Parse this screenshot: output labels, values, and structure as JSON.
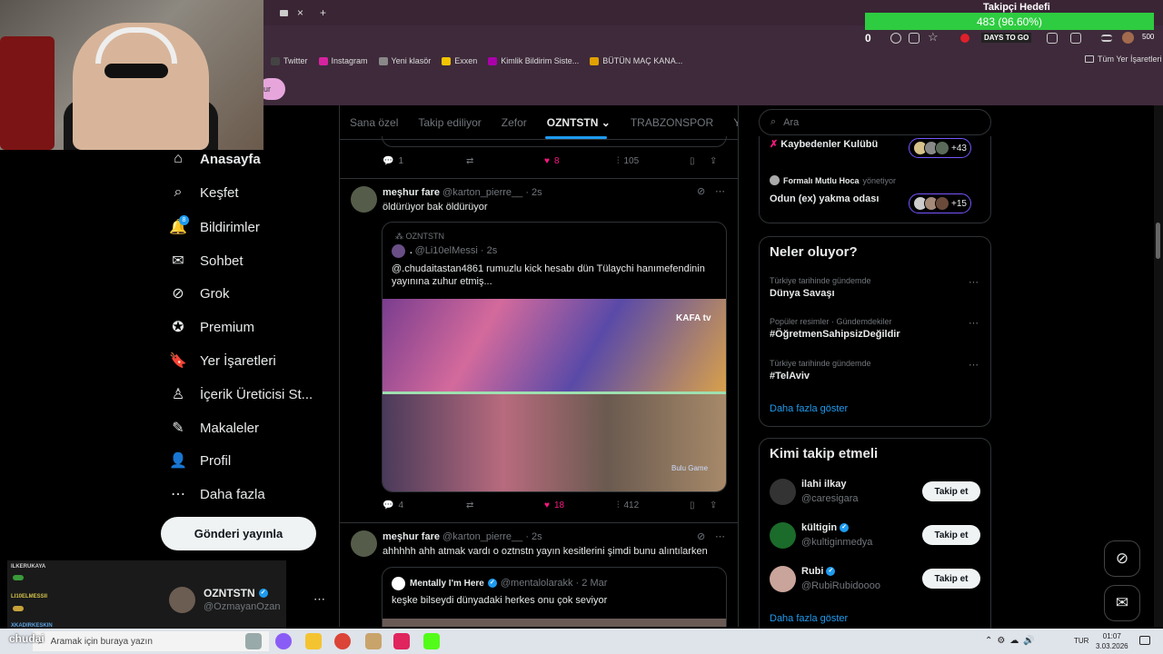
{
  "browser": {
    "tab_close": "×",
    "tab_new": "+",
    "bookmarks": [
      {
        "label": "Twitter",
        "color": "#444"
      },
      {
        "label": "Instagram",
        "color": "#d6249f"
      },
      {
        "label": "Yeni klasör",
        "color": "#888"
      },
      {
        "label": "Exxen",
        "color": "#f2c400"
      },
      {
        "label": "Kimlik Bildirim Siste...",
        "color": "#a0a"
      },
      {
        "label": "BÜTÜN MAÇ KANA...",
        "color": "#e0a000"
      }
    ],
    "all_bookmarks": "Tüm Yer İşaretleri",
    "pill_text": "ur",
    "days_badge": "DAYS TO GO",
    "counter": "500"
  },
  "overlay": {
    "goal_title": "Takipçi Hedefi",
    "goal_text": "483 (96.60%)",
    "goal_progress": 0.966,
    "goal_zero": "0"
  },
  "nav": {
    "items": [
      {
        "label": "Anasayfa",
        "icon": "home-icon",
        "glyph": "⌂"
      },
      {
        "label": "Keşfet",
        "icon": "search-icon",
        "glyph": "⌕"
      },
      {
        "label": "Bildirimler",
        "icon": "bell-icon",
        "glyph": "🔔"
      },
      {
        "label": "Sohbet",
        "icon": "mail-icon",
        "glyph": "✉"
      },
      {
        "label": "Grok",
        "icon": "grok-icon",
        "glyph": "⊘"
      },
      {
        "label": "Premium",
        "icon": "premium-icon",
        "glyph": "✪"
      },
      {
        "label": "Yer İşaretleri",
        "icon": "bookmark-icon",
        "glyph": "🔖"
      },
      {
        "label": "İçerik Üreticisi St...",
        "icon": "creator-icon",
        "glyph": "♙"
      },
      {
        "label": "Makaleler",
        "icon": "articles-icon",
        "glyph": "✎"
      },
      {
        "label": "Profil",
        "icon": "profile-icon",
        "glyph": "👤"
      },
      {
        "label": "Daha fazla",
        "icon": "more-circle-icon",
        "glyph": "⋯"
      }
    ],
    "notif_badge": "8",
    "post_button": "Gönderi yayınla",
    "account_name": "OZNTSTN",
    "account_handle": "@OzmayanOzan",
    "account_more": "⋯"
  },
  "chat": {
    "names": [
      "ILKERUKAYA",
      "LI10ELMESSII",
      "XKADIRKESKIN"
    ]
  },
  "timeline": {
    "tabs": [
      "Sana özel",
      "Takip ediliyor",
      "Zefor",
      "OZNTSTN",
      "TRABZONSPOR",
      "YK"
    ],
    "active_tab": "OZNTSTN",
    "top_actions": {
      "replies": "1",
      "reposts": "",
      "likes": "8",
      "views": "105"
    },
    "posts": [
      {
        "name": "meşhur fare",
        "handle": "@karton_pierre__ · 2s",
        "text": "öldürüyor bak öldürüyor",
        "quote": {
          "community": "OZNTSTN",
          "name": ".",
          "handle": "@Li10elMessi · 2s",
          "text": "@.chudaitastan4861 rumuzlu kick hesabı dün Tülaychi hanımefendinin yayınına zuhur etmiş...",
          "watermark1": "KAFA tv",
          "watermark2": "Bulu Game"
        },
        "actions": {
          "replies": "4",
          "reposts": "",
          "likes": "18",
          "views": "412"
        }
      },
      {
        "name": "meşhur fare",
        "handle": "@karton_pierre__ · 2s",
        "text": "ahhhhh ahh atmak vardı o oztnstn yayın kesitlerini şimdi bunu alıntılarken",
        "quote": {
          "name": "Mentally I'm Here",
          "handle": "@mentalolarakk · 2 Mar",
          "text": "keşke bilseydi dünyadaki herkes onu çok seviyor"
        }
      }
    ]
  },
  "right": {
    "search_placeholder": "Ara",
    "spaces": [
      {
        "title": "Kaybedenler Kulübü",
        "count": "+43"
      },
      {
        "host": "Formalı Mutlu Hoca",
        "host_suffix": "yönetiyor",
        "title": "Odun (ex) yakma odası",
        "count": "+15"
      }
    ],
    "trends_title": "Neler oluyor?",
    "trends": [
      {
        "meta": "Türkiye tarihinde gündemde",
        "name": "Dünya Savaşı"
      },
      {
        "meta": "Popüler resimler · Gündemdekiler",
        "name": "#ÖğretmenSahipsizDeğildir"
      },
      {
        "meta": "Türkiye tarihinde gündemde",
        "name": "#TelAviv"
      }
    ],
    "trends_more": "Daha fazla göster",
    "who_title": "Kimi takip etmeli",
    "suggestions": [
      {
        "name": "ilahi ilkay",
        "handle": "@caresigara",
        "verified": false,
        "color": "#333"
      },
      {
        "name": "kültigin",
        "handle": "@kultiginmedya",
        "verified": true,
        "color": "#1b6b2a"
      },
      {
        "name": "Rubi",
        "handle": "@RubiRubidoooo",
        "verified": true,
        "color": "#c9a49a"
      }
    ],
    "follow_label": "Takip et",
    "who_more": "Daha fazla göster"
  },
  "taskbar": {
    "streamer": "chudai",
    "search_placeholder": "Aramak için buraya yazın",
    "lang": "TUR",
    "time": "01:07",
    "date": "3.03.2026"
  }
}
